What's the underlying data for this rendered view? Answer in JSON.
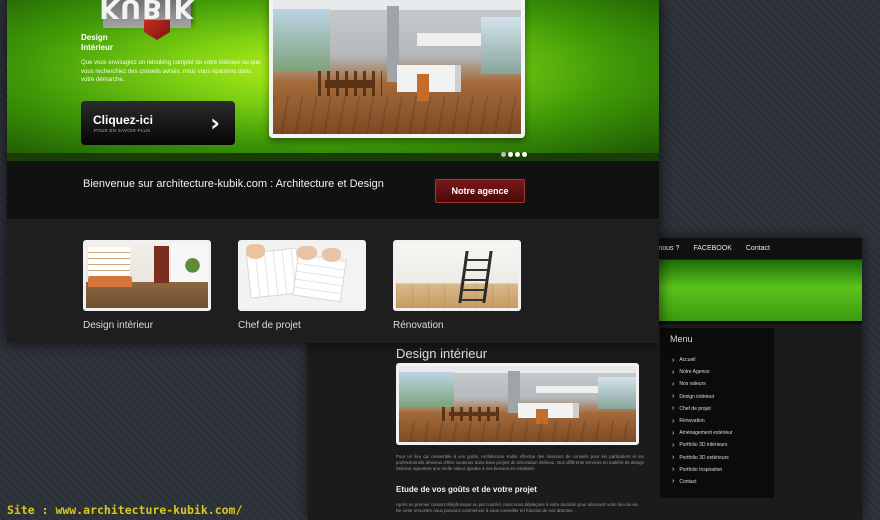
{
  "hero": {
    "title_line1": "Design",
    "title_line2": "Intérieur",
    "description": "Que vous envisagiez un relooking complet de votre intérieur ou que vous recherchiez des conseils avisés, nous vous épaulons dans votre démarche.",
    "cta_label": "Cliquez-ici",
    "cta_sub": "POUR EN SAVOIR PLUS",
    "cta_arrow": "›"
  },
  "welcome": {
    "text": "Bienvenue sur architecture-kubik.com : Architecture et Design",
    "button": "Notre agence"
  },
  "services": [
    {
      "label": "Design intérieur"
    },
    {
      "label": "Chef de projet"
    },
    {
      "label": "Rénovation"
    }
  ],
  "inner_page": {
    "nav": [
      "ymes-nous ?",
      "FACEBOOK",
      "Contact"
    ],
    "title": "Design intérieur",
    "paragraph1": "Pour un lieu qui ressemble à vos goûts, Architecture Kubik effectue des missions de conseils pour les particuliers et les professionnels désireux d'être soutenus dans leurs projets de décoration intérieur. Nos différents services en matière de design intérieur apportent une réelle valeur ajoutée à vos besoins en créativité.",
    "heading2": "Etude de vos goûts et de votre projet",
    "paragraph2": "Après un premier contact téléphonique ou par courriel, nous nous déplaçons à votre domicile pour découvrir votre lieu de vie. De cette rencontre nous pouvons commencer à vous conseiller en fonction de vos attentes :",
    "menu_title": "Menu",
    "menu_items": [
      "Accueil",
      "Notre Agence",
      "Nos valeurs",
      "Design intérieur",
      "Chef de projet",
      "Rénovation",
      "Aménagement extérieur",
      "Portfolio 3D intérieurs",
      "Portfolio 3D extérieurs",
      "Portfolio Inspiration",
      "Contact"
    ]
  },
  "caption": "Site : www.architecture-kubik.com/"
}
